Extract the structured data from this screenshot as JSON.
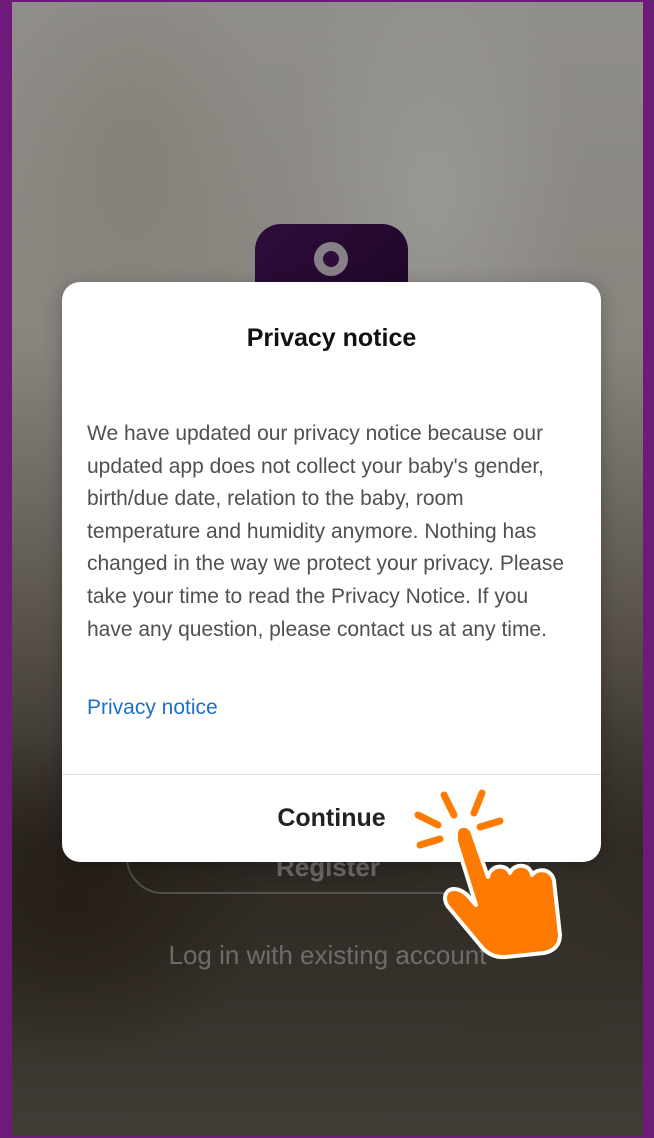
{
  "background": {
    "register_label": "Register",
    "login_link_label": "Log in with existing account"
  },
  "dialog": {
    "title": "Privacy notice",
    "body": "We have updated our privacy notice because our updated app does not collect your baby's gender, birth/due date, relation to the baby, room temperature and humidity anymore. Nothing has changed in the way we protect your privacy. Please take your time to read the Privacy Notice. If you have any question, please contact us at any time.",
    "link_label": "Privacy notice",
    "continue_label": "Continue"
  },
  "colors": {
    "frame": "#6e1a7a",
    "logo": "#4b1460",
    "link": "#1f6fc6",
    "tap_hint": "#ff7a00"
  },
  "icons": {
    "app_logo": "baby-monitor-camera-icon",
    "tap_hint": "tap-hand-icon"
  }
}
